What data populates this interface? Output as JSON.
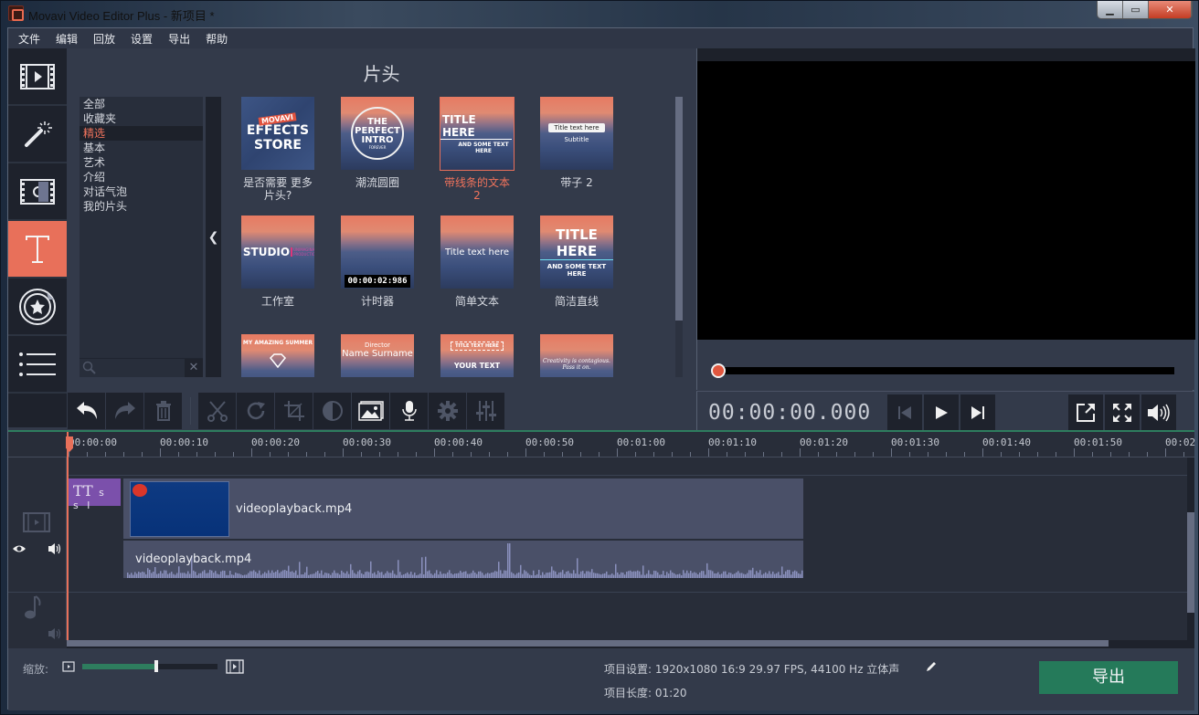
{
  "window": {
    "title": "Movavi Video Editor Plus - 新项目 *",
    "controls": [
      "minimize",
      "maximize",
      "close"
    ]
  },
  "menu": [
    "文件",
    "编辑",
    "回放",
    "设置",
    "导出",
    "帮助"
  ],
  "sidebar": {
    "items": [
      {
        "name": "import-media",
        "icon": "film-play-icon",
        "active": false
      },
      {
        "name": "filters",
        "icon": "magic-wand-icon",
        "active": false
      },
      {
        "name": "transitions",
        "icon": "film-transition-icon",
        "active": false
      },
      {
        "name": "titles",
        "icon": "text-t-icon",
        "active": true
      },
      {
        "name": "stickers",
        "icon": "sticker-star-icon",
        "active": false
      },
      {
        "name": "more-tools",
        "icon": "list-icon",
        "active": false
      }
    ]
  },
  "titles_panel": {
    "heading": "片头",
    "categories": [
      {
        "label": "全部",
        "selected": false
      },
      {
        "label": "收藏夹",
        "selected": false
      },
      {
        "label": "精选",
        "selected": true
      },
      {
        "label": "基本",
        "selected": false
      },
      {
        "label": "艺术",
        "selected": false
      },
      {
        "label": "介绍",
        "selected": false
      },
      {
        "label": "对话气泡",
        "selected": false
      },
      {
        "label": "我的片头",
        "selected": false
      }
    ],
    "search_placeholder": "",
    "tiles": [
      {
        "label": "是否需要 更多 片头?",
        "thumb_lines": [
          "MOVAVI",
          "EFFECTS",
          "STORE"
        ],
        "selected": false
      },
      {
        "label": "潮流圆圈",
        "thumb_lines": [
          "THE",
          "PERFECT",
          "INTRO",
          "FOREVER"
        ],
        "selected": false
      },
      {
        "label": "带线条的文本 2",
        "thumb_lines": [
          "TITLE HERE",
          "AND SOME TEXT HERE"
        ],
        "selected": true
      },
      {
        "label": "带子 2",
        "thumb_lines": [
          "Title text here",
          "Subtitle"
        ],
        "selected": false
      },
      {
        "label": "工作室",
        "thumb_lines": [
          "STUDIO",
          "UNIMAGINABLE PRODUCTION"
        ],
        "selected": false
      },
      {
        "label": "计时器",
        "thumb_lines": [
          "00:00:02:986"
        ],
        "selected": false
      },
      {
        "label": "简单文本",
        "thumb_lines": [
          "Title text here"
        ],
        "selected": false
      },
      {
        "label": "简洁直线",
        "thumb_lines": [
          "TITLE HERE",
          "AND SOME TEXT HERE"
        ],
        "selected": false
      },
      {
        "label": "",
        "thumb_lines": [
          "MY AMAZING SUMMER"
        ],
        "selected": false
      },
      {
        "label": "",
        "thumb_lines": [
          "Director",
          "Name Surname"
        ],
        "selected": false
      },
      {
        "label": "",
        "thumb_lines": [
          "TITLE TEXT HERE",
          "YOUR TEXT"
        ],
        "selected": false
      },
      {
        "label": "",
        "thumb_lines": [
          "Creativity is contagious.",
          "Pass it on."
        ],
        "selected": false
      }
    ]
  },
  "edit_toolbar": [
    {
      "name": "undo",
      "icon": "undo-icon",
      "enabled": true
    },
    {
      "name": "redo",
      "icon": "redo-icon",
      "enabled": false
    },
    {
      "name": "delete",
      "icon": "trash-icon",
      "enabled": false
    },
    {
      "name": "cut",
      "icon": "scissors-icon",
      "enabled": false
    },
    {
      "name": "rotate",
      "icon": "rotate-icon",
      "enabled": false
    },
    {
      "name": "crop",
      "icon": "crop-icon",
      "enabled": false
    },
    {
      "name": "color-adjust",
      "icon": "contrast-icon",
      "enabled": false
    },
    {
      "name": "image",
      "icon": "image-icon",
      "enabled": true
    },
    {
      "name": "record-audio",
      "icon": "microphone-icon",
      "enabled": true
    },
    {
      "name": "settings",
      "icon": "gear-icon",
      "enabled": false
    },
    {
      "name": "equalizer",
      "icon": "equalizer-icon",
      "enabled": false
    }
  ],
  "player": {
    "timecode": "00:00:00.000",
    "progress": 0
  },
  "timeline": {
    "ruler_ticks": [
      "00:00:00",
      "00:00:10",
      "00:00:20",
      "00:00:30",
      "00:00:40",
      "00:00:50",
      "00:01:00",
      "00:01:10",
      "00:01:20",
      "00:01:30",
      "00:01:40",
      "00:01:50",
      "00:02"
    ],
    "title_clip": {
      "icon_text": "TT",
      "text": "s s l"
    },
    "video_clip": {
      "name": "videoplayback.mp4"
    },
    "audio_clip": {
      "name": "videoplayback.mp4"
    }
  },
  "bottom": {
    "zoom_label": "缩放:",
    "zoom_level": 0.55,
    "project_settings_label": "项目设置:",
    "project_settings_value": "1920x1080 16:9 29.97 FPS, 44100 Hz 立体声",
    "project_length_label": "项目长度:",
    "project_length_value": "01:20",
    "export_label": "导出"
  },
  "colors": {
    "accent": "#e8705a",
    "export_green": "#257a5a",
    "title_clip": "#7b50ab",
    "waveform": "#8a90bd"
  }
}
